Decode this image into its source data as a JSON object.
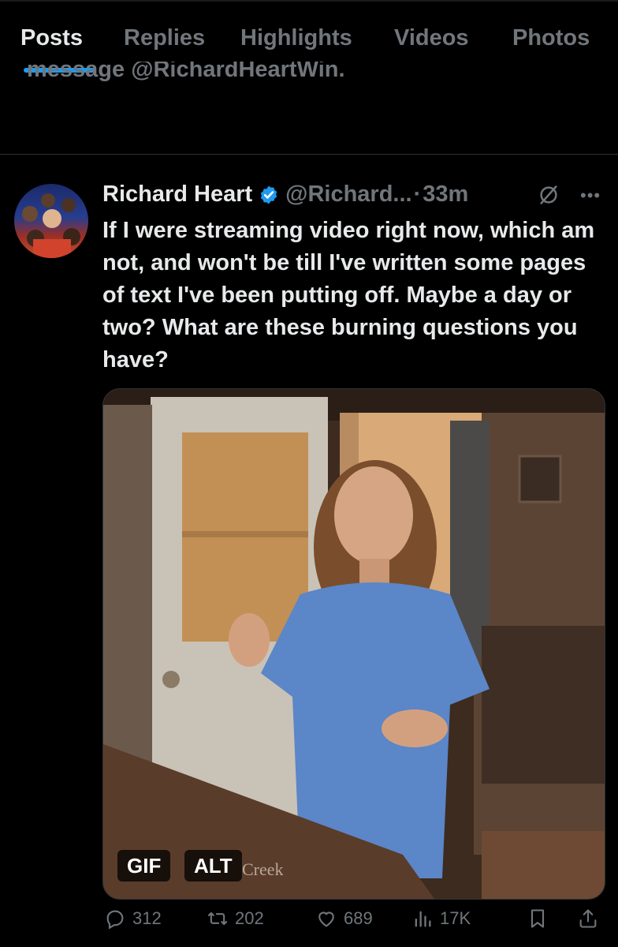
{
  "tabs": [
    {
      "label": "Posts",
      "active": true
    },
    {
      "label": "Replies",
      "active": false
    },
    {
      "label": "Highlights",
      "active": false
    },
    {
      "label": "Videos",
      "active": false
    },
    {
      "label": "Photos",
      "active": false
    }
  ],
  "prev_post_cut_text": "message @RichardHeartWin.",
  "tweet": {
    "author": "Richard Heart",
    "handle": "@Richard...",
    "separator": "·",
    "time": "33m",
    "text": "If I were streaming video right now, which am not, and won't be till I've written some pages of text I've been putting off. Maybe a day or two? What are these burning questions you have?",
    "media": {
      "gif_badge": "GIF",
      "alt_badge": "ALT",
      "watermark": "Creek"
    },
    "actions": {
      "replies": "312",
      "reposts": "202",
      "likes": "689",
      "views": "17K"
    }
  },
  "colors": {
    "accent": "#1d9bf0",
    "muted": "#71767b",
    "text": "#e7e9ea",
    "background": "#000000"
  }
}
